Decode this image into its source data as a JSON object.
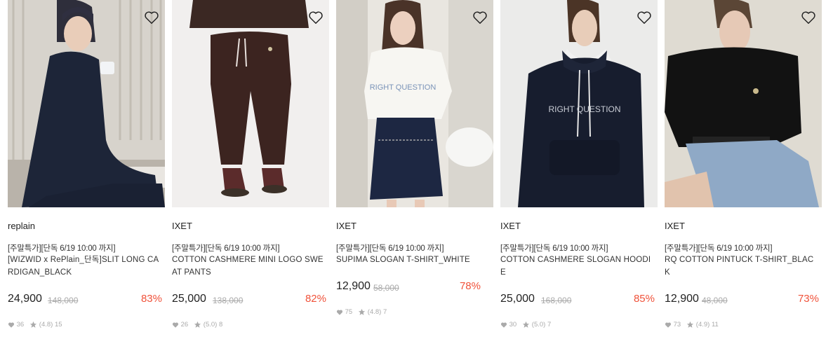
{
  "colors": {
    "discount": "#f0523a",
    "muted": "#aaaaaa",
    "text": "#222222"
  },
  "products": [
    {
      "brand": "replain",
      "promo": "[주말특가][단독 6/19 10:00 까지]",
      "name": "[WIZWID x RePlain_단독]SLIT LONG CARDIGAN_BLACK",
      "price": "24,900",
      "original_price": "148,000",
      "discount": "83%",
      "likes": "36",
      "rating": "(4.8)",
      "reviews": "15",
      "wishlist_icon": "heart-outline-icon"
    },
    {
      "brand": "IXET",
      "promo": "[주말특가][단독 6/19 10:00 까지]",
      "name": "COTTON CASHMERE MINI LOGO SWEAT PANTS",
      "price": "25,000",
      "original_price": "138,000",
      "discount": "82%",
      "likes": "26",
      "rating": "(5.0)",
      "reviews": "8",
      "wishlist_icon": "heart-outline-icon"
    },
    {
      "brand": "IXET",
      "promo": "[주말특가][단독 6/19 10:00 까지]",
      "name": "SUPIMA SLOGAN T-SHIRT_WHITE",
      "price": "12,900",
      "original_price": "58,000",
      "discount": "78%",
      "likes": "75",
      "rating": "(4.8)",
      "reviews": "7",
      "wishlist_icon": "heart-outline-icon"
    },
    {
      "brand": "IXET",
      "promo": "[주말특가][단독 6/19 10:00 까지]",
      "name": "COTTON CASHMERE SLOGAN HOODIE",
      "price": "25,000",
      "original_price": "168,000",
      "discount": "85%",
      "likes": "30",
      "rating": "(5.0)",
      "reviews": "7",
      "wishlist_icon": "heart-outline-icon"
    },
    {
      "brand": "IXET",
      "promo": "[주말특가][단독 6/19 10:00 까지]",
      "name": "RQ COTTON PINTUCK T-SHIRT_BLACK",
      "price": "12,900",
      "original_price": "48,000",
      "discount": "73%",
      "likes": "73",
      "rating": "(4.9)",
      "reviews": "11",
      "wishlist_icon": "heart-outline-icon"
    }
  ]
}
